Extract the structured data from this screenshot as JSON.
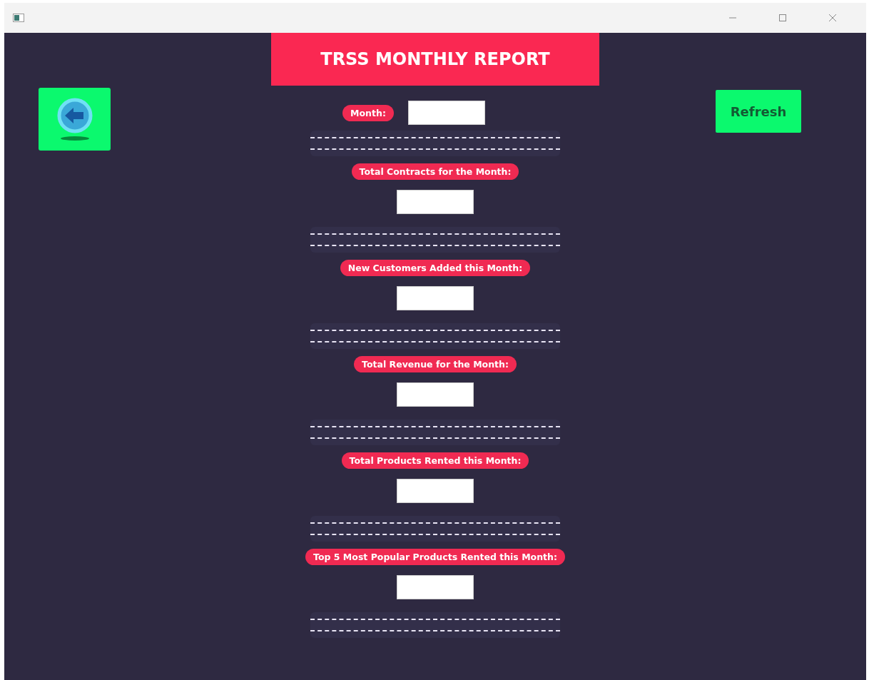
{
  "header": {
    "title": "TRSS MONTHLY REPORT"
  },
  "refresh_button": {
    "label": "Refresh"
  },
  "month": {
    "label": "Month:"
  },
  "sections": [
    {
      "label": "Total Contracts for the Month:"
    },
    {
      "label": "New Customers Added this Month:"
    },
    {
      "label": "Total Revenue for the Month:"
    },
    {
      "label": "Total Products Rented this Month:"
    },
    {
      "label": "Top 5 Most Popular Products Rented this Month:"
    }
  ]
}
